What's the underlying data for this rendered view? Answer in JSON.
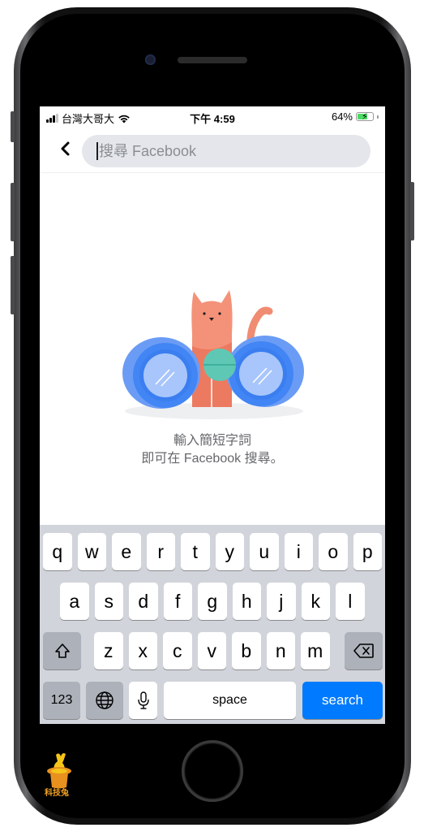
{
  "status_bar": {
    "carrier": "台灣大哥大",
    "time": "下午 4:59",
    "battery_percent": "64%",
    "battery_level": 0.64,
    "charging": true,
    "signal_bars": 3,
    "signal_bars_total": 4
  },
  "search": {
    "placeholder": "搜尋 Facebook",
    "value": ""
  },
  "empty_state": {
    "line1": "輸入簡短字詞",
    "line2": "即可在 Facebook 搜尋。"
  },
  "keyboard": {
    "row1": [
      "q",
      "w",
      "e",
      "r",
      "t",
      "y",
      "u",
      "i",
      "o",
      "p"
    ],
    "row2": [
      "a",
      "s",
      "d",
      "f",
      "g",
      "h",
      "j",
      "k",
      "l"
    ],
    "row3": [
      "z",
      "x",
      "c",
      "v",
      "b",
      "n",
      "m"
    ],
    "numbers_label": "123",
    "space_label": "space",
    "search_label": "search"
  },
  "watermark": {
    "text": "科技兔"
  },
  "colors": {
    "accent_blue": "#007aff",
    "search_bg": "#e4e6eb",
    "keyboard_bg": "#d1d4da",
    "cat": "#f08c72",
    "binocular_blue": "#4285f4",
    "lollipop": "#5ec8b4"
  }
}
